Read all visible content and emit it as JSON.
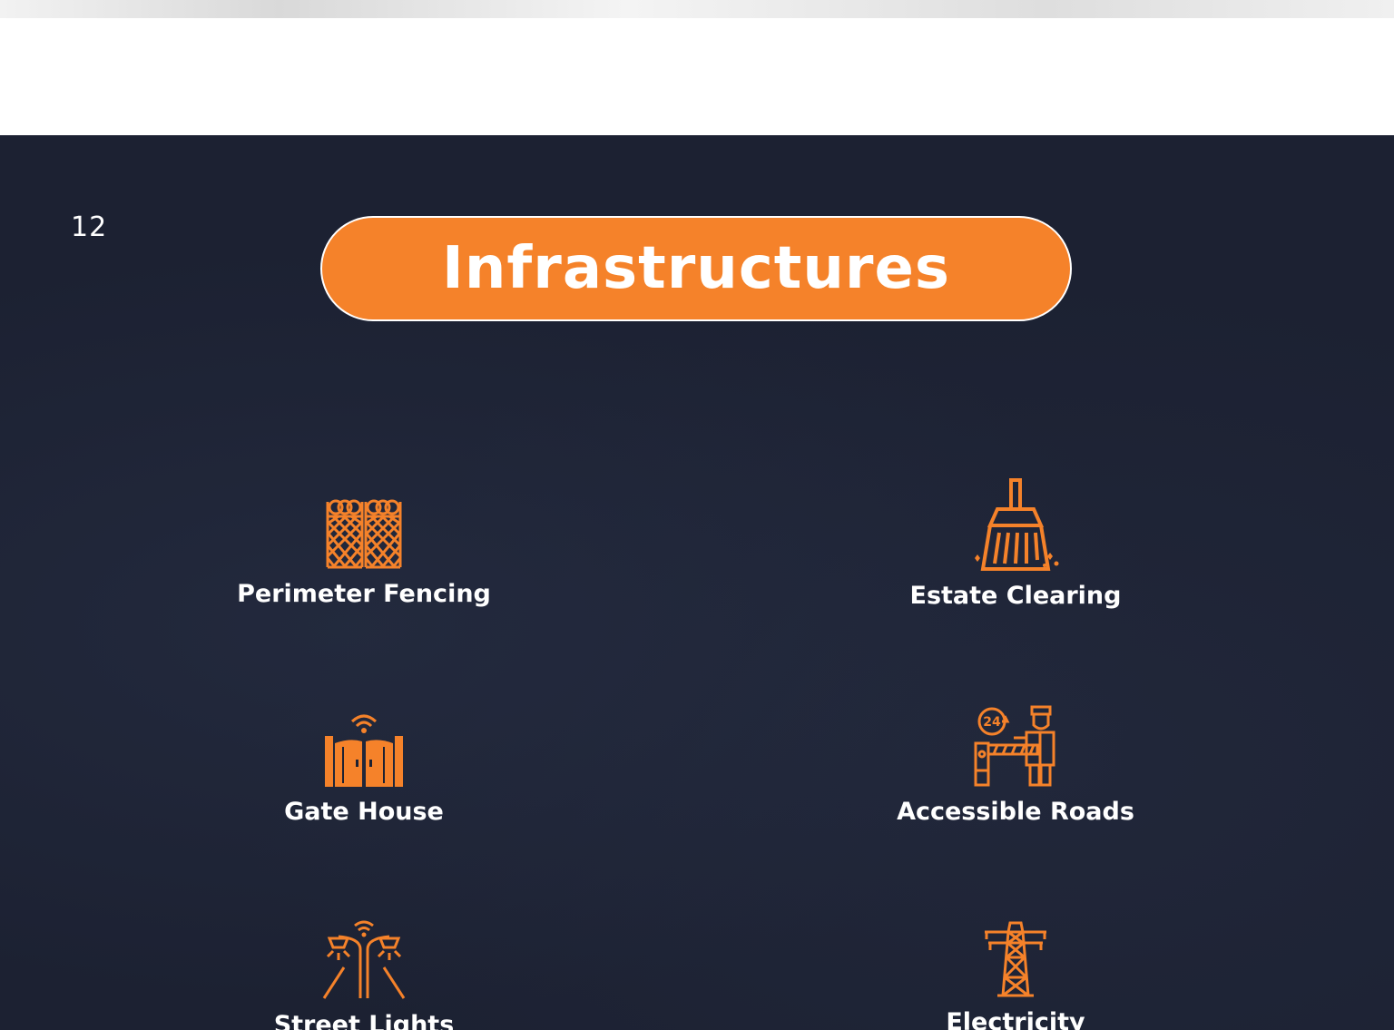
{
  "slide": {
    "page_number": "12",
    "title": "Infrastructures",
    "accent_color": "#f5822a",
    "background_color": "#1c2132",
    "features": [
      {
        "label": "Perimeter Fencing",
        "icon": "fence-icon"
      },
      {
        "label": "Estate Clearing",
        "icon": "broom-icon"
      },
      {
        "label": "Gate House",
        "icon": "gate-icon"
      },
      {
        "label": "Accessible Roads",
        "icon": "security-barrier-icon"
      },
      {
        "label": "Street Lights",
        "icon": "street-light-icon"
      },
      {
        "label": "Electricity",
        "icon": "power-tower-icon"
      }
    ]
  }
}
